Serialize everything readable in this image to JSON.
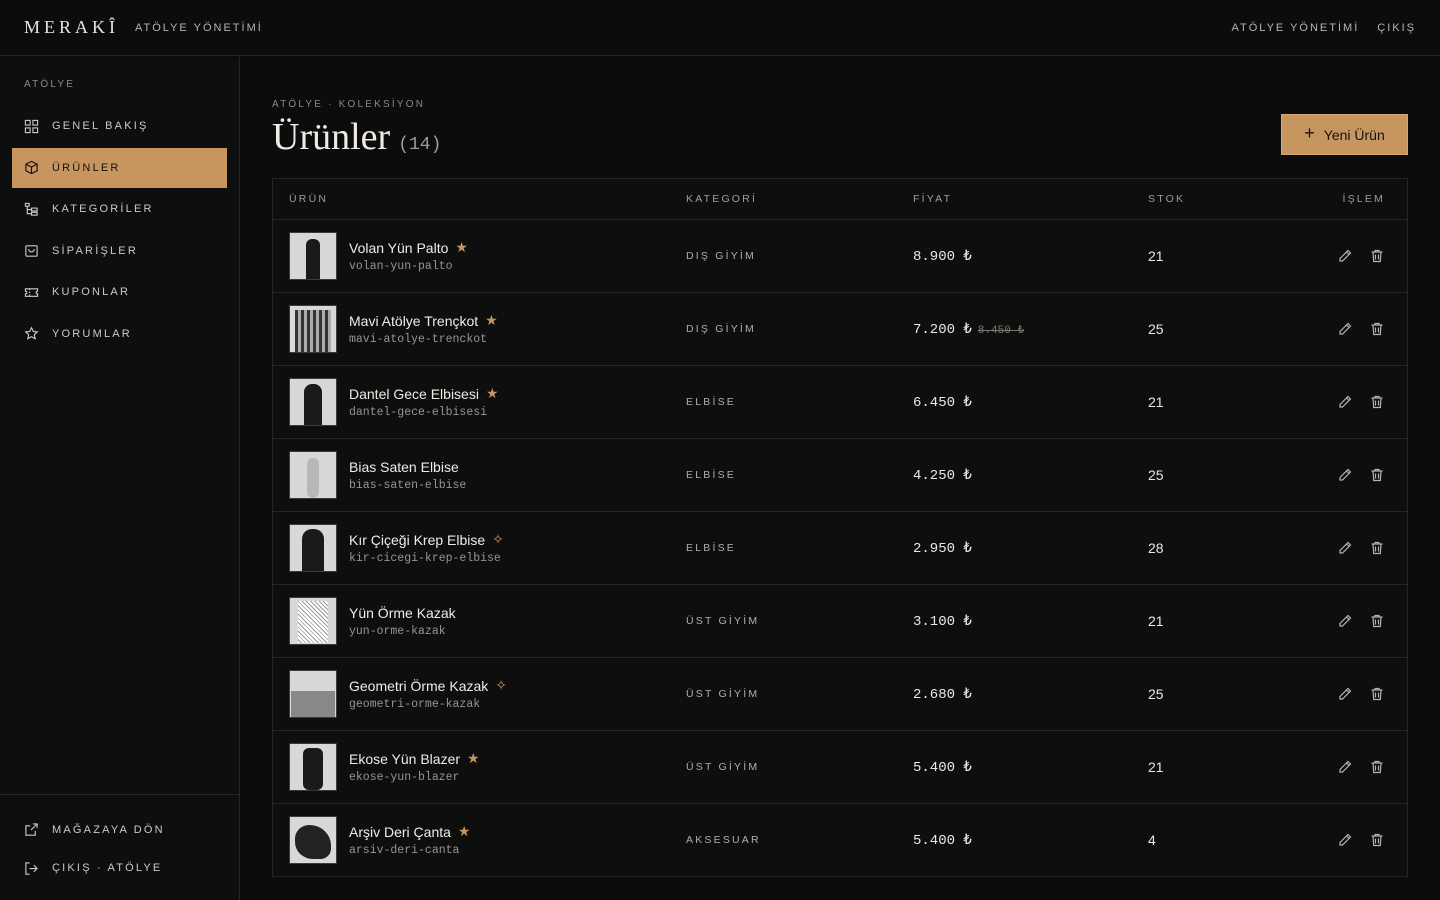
{
  "header": {
    "logo": "MERAKÎ",
    "subtitle": "ATÖLYE YÖNETİMİ",
    "right_link": "ATÖLYE YÖNETİMİ",
    "logout": "ÇIKIŞ"
  },
  "sidebar": {
    "section": "ATÖLYE",
    "items": [
      {
        "label": "GENEL BAKIŞ",
        "icon": "grid-icon"
      },
      {
        "label": "ÜRÜNLER",
        "icon": "box-icon"
      },
      {
        "label": "KATEGORİLER",
        "icon": "tree-icon"
      },
      {
        "label": "SİPARİŞLER",
        "icon": "bag-icon"
      },
      {
        "label": "KUPONLAR",
        "icon": "ticket-icon"
      },
      {
        "label": "YORUMLAR",
        "icon": "star-icon"
      }
    ],
    "bottom": [
      {
        "label": "MAĞAZAYA DÖN",
        "icon": "external-link-icon"
      },
      {
        "label": "ÇIKIŞ · ATÖLYE",
        "icon": "logout-icon"
      }
    ]
  },
  "page": {
    "breadcrumb": "ATÖLYE · KOLEKSİYON",
    "title": "Ürünler",
    "count": "(14)",
    "new_button": "Yeni Ürün"
  },
  "table": {
    "headers": {
      "product": "ÜRÜN",
      "category": "KATEGORİ",
      "price": "FİYAT",
      "stock": "STOK",
      "action": "İŞLEM"
    },
    "rows": [
      {
        "name": "Volan Yün Palto",
        "slug": "volan-yun-palto",
        "category": "DIŞ GİYİM",
        "price": "8.900 ₺",
        "old_price": "",
        "stock": "21",
        "badge": "★"
      },
      {
        "name": "Mavi Atölye Trençkot",
        "slug": "mavi-atolye-trenckot",
        "category": "DIŞ GİYİM",
        "price": "7.200 ₺",
        "old_price": "8.450 ₺",
        "stock": "25",
        "badge": "★"
      },
      {
        "name": "Dantel Gece Elbisesi",
        "slug": "dantel-gece-elbisesi",
        "category": "ELBİSE",
        "price": "6.450 ₺",
        "old_price": "",
        "stock": "21",
        "badge": "★"
      },
      {
        "name": "Bias Saten Elbise",
        "slug": "bias-saten-elbise",
        "category": "ELBİSE",
        "price": "4.250 ₺",
        "old_price": "",
        "stock": "25",
        "badge": ""
      },
      {
        "name": "Kır Çiçeği Krep Elbise",
        "slug": "kir-cicegi-krep-elbise",
        "category": "ELBİSE",
        "price": "2.950 ₺",
        "old_price": "",
        "stock": "28",
        "badge": "✧"
      },
      {
        "name": "Yün Örme Kazak",
        "slug": "yun-orme-kazak",
        "category": "ÜST GİYİM",
        "price": "3.100 ₺",
        "old_price": "",
        "stock": "21",
        "badge": ""
      },
      {
        "name": "Geometri Örme Kazak",
        "slug": "geometri-orme-kazak",
        "category": "ÜST GİYİM",
        "price": "2.680 ₺",
        "old_price": "",
        "stock": "25",
        "badge": "✧"
      },
      {
        "name": "Ekose Yün Blazer",
        "slug": "ekose-yun-blazer",
        "category": "ÜST GİYİM",
        "price": "5.400 ₺",
        "old_price": "",
        "stock": "21",
        "badge": "★"
      },
      {
        "name": "Arşiv Deri Çanta",
        "slug": "arsiv-deri-canta",
        "category": "AKSESUAR",
        "price": "5.400 ₺",
        "old_price": "",
        "stock": "4",
        "badge": "★"
      }
    ]
  },
  "colors": {
    "accent": "#c69560",
    "background": "#0c0c0d",
    "border": "#26262a"
  }
}
